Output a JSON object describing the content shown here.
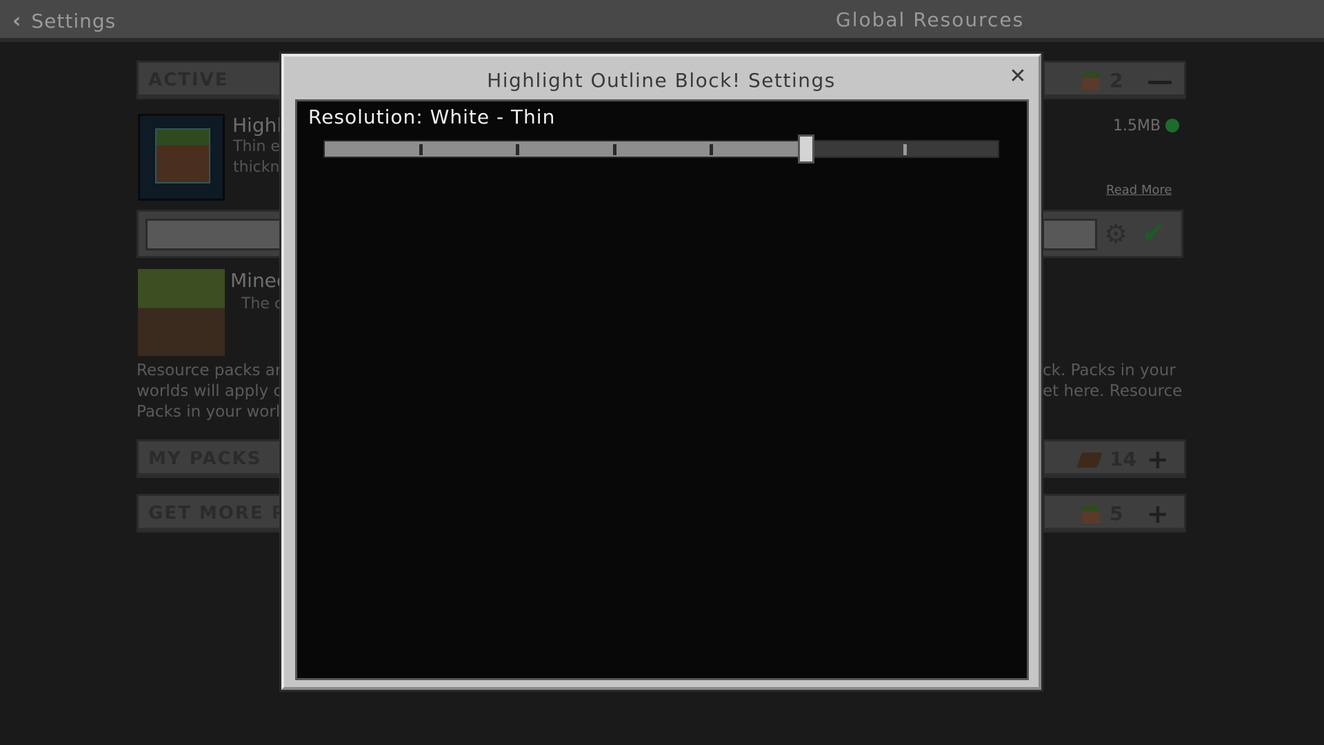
{
  "header": {
    "back_label": "Settings",
    "title": "Global Resources"
  },
  "sections": {
    "active": {
      "label": "ACTIVE",
      "count": "2",
      "action_icon": "minus-icon"
    },
    "my_packs": {
      "label": "MY PACKS",
      "count": "14",
      "action_icon": "plus-icon"
    },
    "get_more": {
      "label": "GET MORE PAC",
      "count": "5",
      "action_icon": "plus-icon"
    }
  },
  "packs": [
    {
      "name": "Highl",
      "desc_line1": "Thin e",
      "desc_line2": "thickn",
      "size": "1.5MB",
      "read_more": "Read More"
    },
    {
      "name": "Minec",
      "desc_line1": "The c"
    }
  ],
  "info": {
    "left_1": "Resource packs are",
    "left_2": "worlds will apply o",
    "left_3": "Packs in your world",
    "right_1": "ck. Packs in your",
    "right_2": "et here. Resource"
  },
  "modal": {
    "title": "Highlight Outline Block! Settings",
    "close_icon": "close-icon",
    "slider": {
      "label": "Resolution: White - Thin",
      "value_fraction": 0.715,
      "ticks": [
        0.14,
        0.284,
        0.428,
        0.572,
        0.716,
        0.86
      ]
    }
  },
  "colors": {
    "accent_green": "#1e6b2e",
    "modal_bg": "#c6c6c6",
    "body_bg": "#080808"
  }
}
